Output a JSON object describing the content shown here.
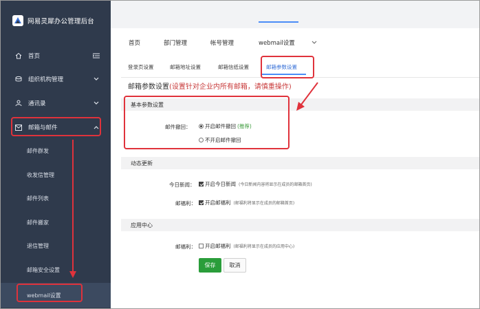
{
  "app": {
    "title": "网易灵犀办公管理后台"
  },
  "sidebar": {
    "items": [
      {
        "label": "首页",
        "icon": "home-icon"
      },
      {
        "label": "组织机构管理",
        "icon": "org-icon"
      },
      {
        "label": "通讯录",
        "icon": "contacts-icon"
      },
      {
        "label": "邮箱与邮件",
        "icon": "mail-icon"
      }
    ],
    "subitems": [
      {
        "label": "邮件群发"
      },
      {
        "label": "收发信管理"
      },
      {
        "label": "邮件列表"
      },
      {
        "label": "邮件搬家"
      },
      {
        "label": "退信管理"
      },
      {
        "label": "邮箱安全设置"
      },
      {
        "label": "webmail设置"
      }
    ]
  },
  "tabs": {
    "primary": [
      "首页",
      "部门管理",
      "帐号管理",
      "webmail设置"
    ],
    "secondary": [
      "登录页设置",
      "邮箱地址设置",
      "邮箱信纸设置",
      "邮箱参数设置"
    ]
  },
  "page": {
    "title": "邮箱参数设置",
    "title_warning": "(设置针对企业内所有邮箱，请慎重操作)"
  },
  "sections": {
    "basic": {
      "title": "基本参数设置",
      "recall_label": "邮件撤回：",
      "recall_on": "开启邮件撤回",
      "recall_recommend": "(推荐)",
      "recall_off": "不开启邮件撤回"
    },
    "dynamic": {
      "title": "动态更新",
      "news_label": "今日新闻：",
      "news_option": "开启今日新闻",
      "news_hint": "(今日新闻内容将显示在成员的邮箱首页)",
      "welfare_label": "邮福利：",
      "welfare_option": "开启邮福利",
      "welfare_hint": "(邮福利将显示在成员的邮箱首页)"
    },
    "apps": {
      "title": "应用中心",
      "welfare_label": "邮福利：",
      "welfare_option": "开启邮福利",
      "welfare_hint": "(邮福利将显示在成员的应用中心)"
    }
  },
  "buttons": {
    "save": "保存",
    "cancel": "取消"
  },
  "colors": {
    "sidebar_bg": "#2f3a4c",
    "accent": "#4a8cf7",
    "annotation": "#e0323b",
    "save": "#2a9d3a",
    "warning": "#c83a3a"
  }
}
